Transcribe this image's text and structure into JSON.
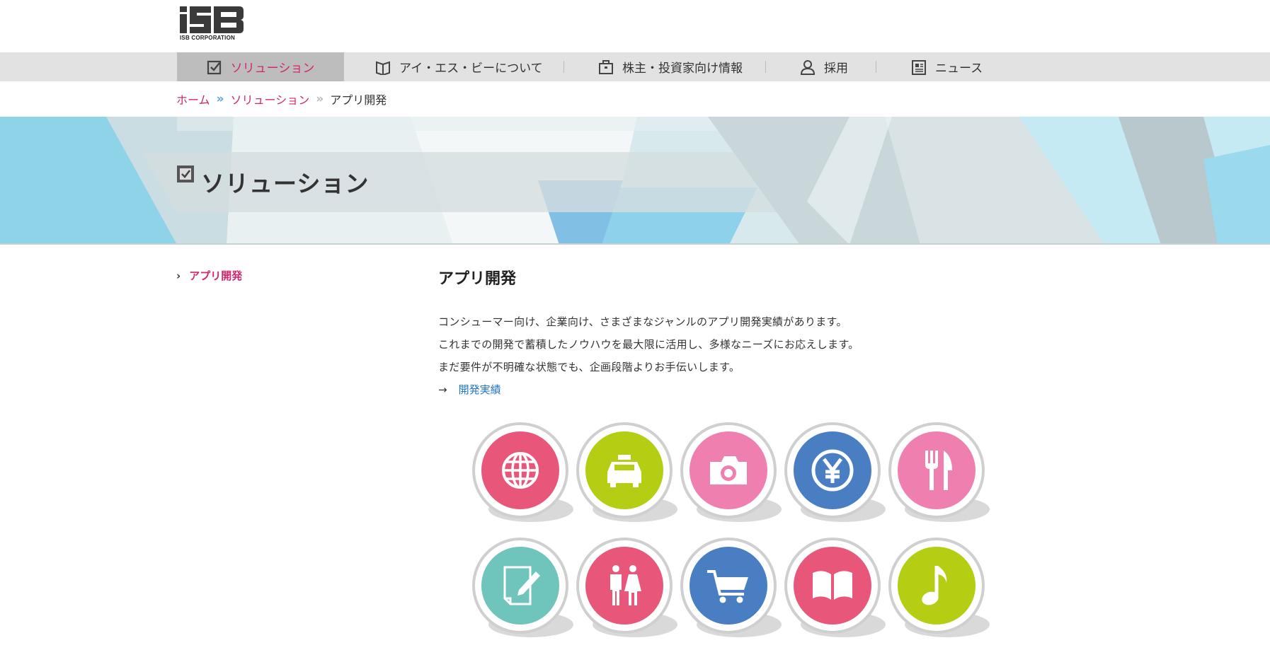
{
  "header": {
    "logo_text": "iSB",
    "logo_sub": "ISB CORPORATION"
  },
  "nav": {
    "items": [
      {
        "label": "ソリューション",
        "icon": "checkbox-icon",
        "active": true
      },
      {
        "label": "アイ・エス・ビーについて",
        "icon": "book-icon",
        "active": false
      },
      {
        "label": "株主・投資家向け情報",
        "icon": "briefcase-icon",
        "active": false
      },
      {
        "label": "採用",
        "icon": "person-icon",
        "active": false
      },
      {
        "label": "ニュース",
        "icon": "newspaper-icon",
        "active": false
      }
    ]
  },
  "breadcrumb": {
    "home": "ホーム",
    "level1": "ソリューション",
    "current": "アプリ開発",
    "sep": "»"
  },
  "hero": {
    "title": "ソリューション"
  },
  "sidebar": {
    "items": [
      {
        "label": "アプリ開発",
        "chevron": "›"
      }
    ]
  },
  "main": {
    "title": "アプリ開発",
    "paragraphs": [
      "コンシューマー向け、企業向け、さまざまなジャンルのアプリ開発実績があります。",
      "これまでの開発で蓄積したノウハウを最大限に活用し、多様なニーズにお応えします。",
      "まだ要件が不明確な状態でも、企画段階よりお手伝いします。"
    ],
    "more_arrow": "→",
    "more_link": "開発実績"
  },
  "genre_icons": [
    {
      "name": "globe-icon",
      "color": "#e8577a"
    },
    {
      "name": "taxi-icon",
      "color": "#b5cd13"
    },
    {
      "name": "camera-icon",
      "color": "#ee7fae"
    },
    {
      "name": "yen-icon",
      "color": "#4a7ec3"
    },
    {
      "name": "fork-knife-icon",
      "color": "#ee7fae"
    },
    {
      "name": "memo-pencil-icon",
      "color": "#6fc4bb"
    },
    {
      "name": "people-icon",
      "color": "#e8577a"
    },
    {
      "name": "shopping-cart-icon",
      "color": "#4a7ec3"
    },
    {
      "name": "open-book-icon",
      "color": "#e8577a"
    },
    {
      "name": "music-note-icon",
      "color": "#b5cd13"
    }
  ],
  "colors": {
    "accent": "#d1276f",
    "link": "#2376c5",
    "nav_bg": "#e2e2e2",
    "nav_active_bg": "#bdbdbd"
  }
}
